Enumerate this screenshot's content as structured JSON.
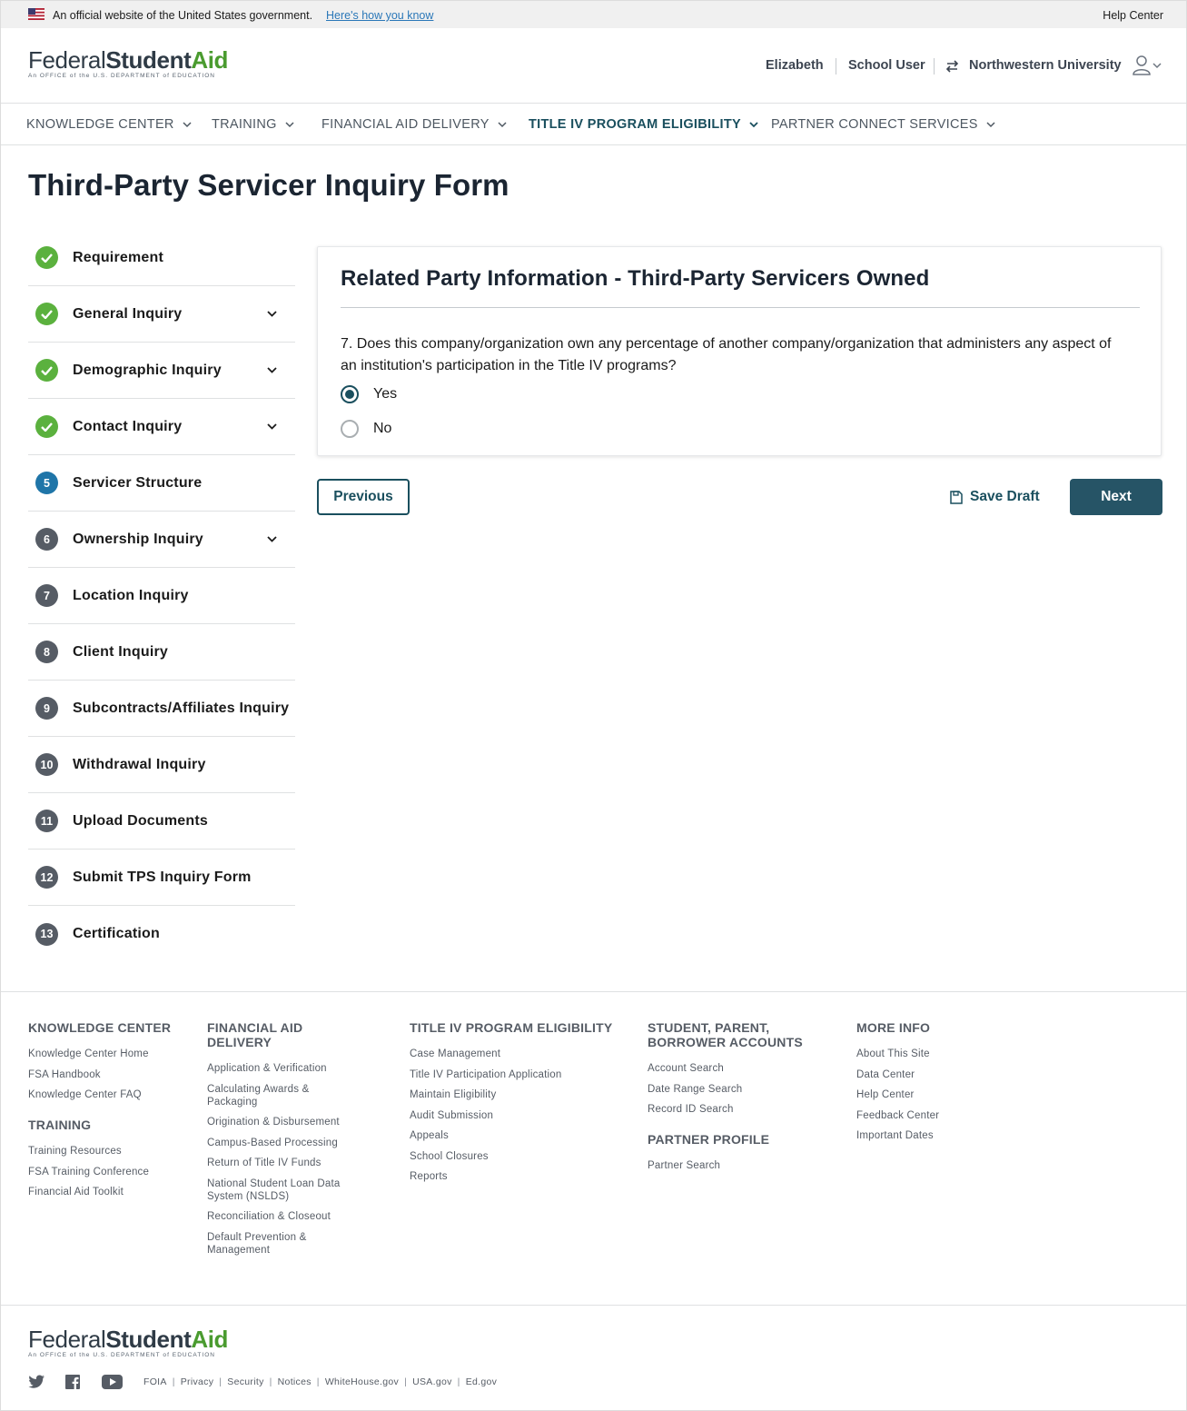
{
  "gov_banner": {
    "text": "An official website of the United States government.",
    "link": "Here's how you know",
    "help": "Help Center"
  },
  "logo": {
    "federal": "Federal",
    "student": "Student",
    "aid": "Aid",
    "subtitle": "An OFFICE of the U.S. DEPARTMENT of EDUCATION"
  },
  "user": {
    "name": "Elizabeth",
    "role": "School User",
    "school": "Northwestern University"
  },
  "nav": [
    {
      "label": "KNOWLEDGE CENTER"
    },
    {
      "label": "TRAINING"
    },
    {
      "label": "FINANCIAL AID DELIVERY"
    },
    {
      "label": "TITLE IV PROGRAM ELIGIBILITY"
    },
    {
      "label": "PARTNER CONNECT SERVICES"
    }
  ],
  "page_title": "Third-Party Servicer Inquiry Form",
  "steps": [
    {
      "num": "",
      "label": "Requirement",
      "state": "done",
      "expandable": false
    },
    {
      "num": "",
      "label": "General Inquiry",
      "state": "done",
      "expandable": true
    },
    {
      "num": "",
      "label": "Demographic Inquiry",
      "state": "done",
      "expandable": true
    },
    {
      "num": "",
      "label": "Contact Inquiry",
      "state": "done",
      "expandable": true
    },
    {
      "num": "5",
      "label": "Servicer Structure",
      "state": "current",
      "expandable": false
    },
    {
      "num": "6",
      "label": "Ownership Inquiry",
      "state": "todo",
      "expandable": true
    },
    {
      "num": "7",
      "label": "Location Inquiry",
      "state": "todo",
      "expandable": false
    },
    {
      "num": "8",
      "label": "Client Inquiry",
      "state": "todo",
      "expandable": false
    },
    {
      "num": "9",
      "label": "Subcontracts/Affiliates Inquiry",
      "state": "todo",
      "expandable": false
    },
    {
      "num": "10",
      "label": "Withdrawal Inquiry",
      "state": "todo",
      "expandable": false
    },
    {
      "num": "11",
      "label": "Upload Documents",
      "state": "todo",
      "expandable": false
    },
    {
      "num": "12",
      "label": "Submit TPS Inquiry Form",
      "state": "todo",
      "expandable": false
    },
    {
      "num": "13",
      "label": "Certification",
      "state": "todo",
      "expandable": false
    }
  ],
  "card": {
    "title": "Related Party Information - Third-Party Servicers Owned",
    "question": "7. Does this company/organization own any percentage of another company/organization that administers any aspect of an institution's participation in the Title IV programs?",
    "options": [
      {
        "label": "Yes",
        "checked": true
      },
      {
        "label": "No",
        "checked": false
      }
    ]
  },
  "actions": {
    "previous": "Previous",
    "save_draft": "Save Draft",
    "next": "Next"
  },
  "footer": {
    "knowledge": {
      "heading": "KNOWLEDGE CENTER",
      "links": [
        "Knowledge Center Home",
        "FSA Handbook",
        "Knowledge Center FAQ"
      ]
    },
    "training": {
      "heading": "TRAINING",
      "links": [
        "Training Resources",
        "FSA Training Conference",
        "Financial Aid Toolkit"
      ]
    },
    "delivery": {
      "heading": "FINANCIAL AID DELIVERY",
      "links": [
        "Application & Verification",
        "Calculating Awards & Packaging",
        "Origination & Disbursement",
        "Campus-Based Processing",
        "Return of Title IV Funds",
        "National Student Loan Data System (NSLDS)",
        "Reconciliation & Closeout",
        "Default Prevention & Management"
      ]
    },
    "eligibility": {
      "heading": "TITLE IV PROGRAM ELIGIBILITY",
      "links": [
        "Case Management",
        "Title IV Participation Application",
        "Maintain Eligibility",
        "Audit Submission",
        "Appeals",
        "School Closures",
        "Reports"
      ]
    },
    "accounts": {
      "heading": "STUDENT, PARENT, BORROWER ACCOUNTS",
      "links": [
        "Account Search",
        "Date Range Search",
        "Record ID Search"
      ]
    },
    "partner": {
      "heading": "PARTNER PROFILE",
      "links": [
        "Partner Search"
      ]
    },
    "more": {
      "heading": "MORE INFO",
      "links": [
        "About This Site",
        "Data Center",
        "Help Center",
        "Feedback Center",
        "Important Dates"
      ]
    },
    "legal": [
      "FOIA",
      "Privacy",
      "Security",
      "Notices",
      "WhiteHouse.gov",
      "USA.gov",
      "Ed.gov"
    ]
  },
  "colors": {
    "primary": "#1a4f5e",
    "next_button": "#265466",
    "done": "#5bb13e",
    "current": "#1f75a8",
    "todo": "#565c65",
    "logo_green": "#4a9b2f"
  },
  "icons": {
    "flag": "us-flag-icon",
    "switch": "switch-arrows-icon",
    "user": "user-icon",
    "check": "check-icon",
    "save": "save-icon",
    "twitter": "twitter-icon",
    "facebook": "facebook-icon",
    "youtube": "youtube-icon"
  }
}
